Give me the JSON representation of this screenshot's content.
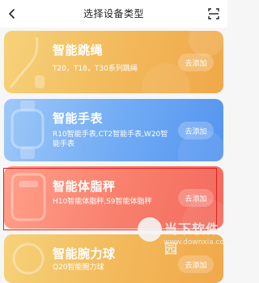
{
  "header": {
    "title": "选择设备类型",
    "back_icon": "chevron-left-icon",
    "scan_icon": "scan-icon"
  },
  "cards": [
    {
      "name": "智能跳绳",
      "desc": "T20，T18，T30系列跳绳",
      "action": "去添加",
      "color": "#f2b85a",
      "icon": "jump-rope-icon"
    },
    {
      "name": "智能手表",
      "desc": "R10智能手表,CT2智能手表,W20智能手表",
      "action": "去添加",
      "color": "#6faaf4",
      "icon": "watch-icon"
    },
    {
      "name": "智能体脂秤",
      "desc": "H10智能体脂秤,S9智能体脂秤",
      "action": "去添加",
      "color": "#f87f6c",
      "icon": "scale-icon"
    },
    {
      "name": "智能腕力球",
      "desc": "Q20智能腕力球",
      "action": "去添加",
      "color": "#f2b85a",
      "icon": "wrist-ball-icon"
    }
  ],
  "watermark": {
    "title": "当下软件园",
    "url": "www.downxia.com"
  }
}
